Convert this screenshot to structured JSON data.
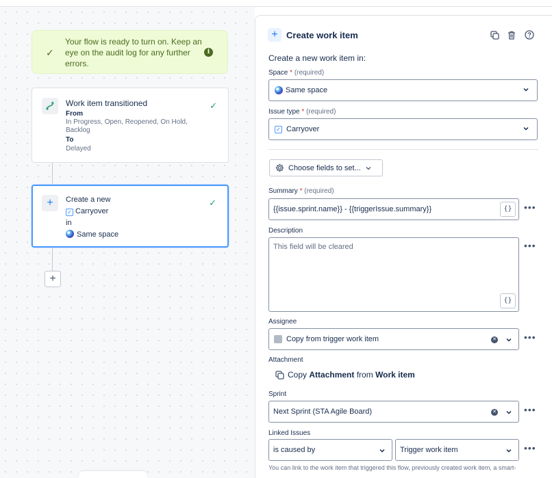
{
  "banner": {
    "message": "Your flow is ready to turn on. Keep an eye on the audit log for any further errors.",
    "info_glyph": "i"
  },
  "trigger": {
    "title": "Work item transitioned",
    "from_label": "From",
    "from_value": "In Progress, Open, Reopened, On Hold, Backlog",
    "to_label": "To",
    "to_value": "Delayed"
  },
  "action": {
    "line1": "Create a new",
    "issue_type": "Carryover",
    "in_label": "in",
    "space": "Same space"
  },
  "panel": {
    "title": "Create work item",
    "subtitle": "Create a new work item in:",
    "space_label": "Space",
    "space_value": "Same space",
    "issue_type_label": "Issue type",
    "issue_type_value": "Carryover",
    "required_star": "*",
    "required_hint": "(required)",
    "choose_fields": "Choose fields to set...",
    "summary_label": "Summary",
    "summary_value": "{{issue.sprint.name}} - {{triggerIssue.summary}}",
    "smart_glyph": "{}",
    "description_label": "Description",
    "description_placeholder": "This field will be cleared",
    "assignee_label": "Assignee",
    "assignee_value": "Copy from trigger work item",
    "attachment_label": "Attachment",
    "attach_copy": "Copy",
    "attach_field": "Attachment",
    "attach_from": "from",
    "attach_source": "Work item",
    "sprint_label": "Sprint",
    "sprint_value": "Next Sprint (STA Agile Board)",
    "linked_label": "Linked Issues",
    "linked_type": "is caused by",
    "linked_target": "Trigger work item",
    "footer_hint": "You can link to the work item that triggered this flow, previously created work item, a smart-",
    "more_glyph": "•••",
    "clear_glyph": "✕"
  },
  "colors": {
    "accent": "#1d7afc",
    "success": "#22a06b",
    "banner_bg": "#eefbd6",
    "banner_text": "#4c6b1f",
    "required": "#c9372c"
  }
}
